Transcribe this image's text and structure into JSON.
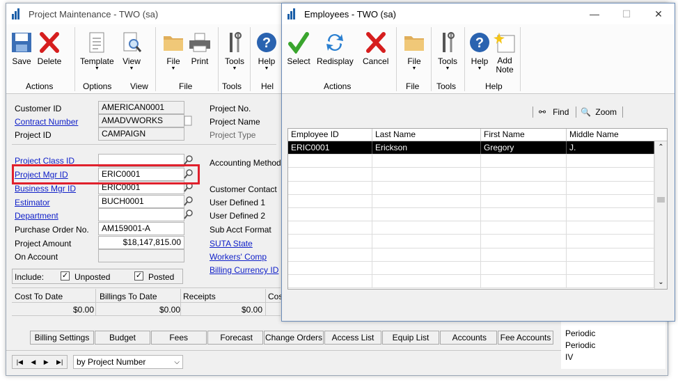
{
  "project_window": {
    "title": "Project Maintenance  -  TWO (sa)",
    "ribbon": {
      "buttons": [
        {
          "label": "Save"
        },
        {
          "label": "Delete"
        },
        {
          "label": "Template"
        },
        {
          "label": "View"
        },
        {
          "label": "File"
        },
        {
          "label": "Print"
        },
        {
          "label": "Tools"
        },
        {
          "label": "Help"
        }
      ],
      "groups": [
        "Actions",
        "Options",
        "View",
        "File",
        "Tools",
        "Hel"
      ]
    },
    "form": {
      "customer_id_label": "Customer ID",
      "customer_id": "AMERICAN0001",
      "contract_number_label": "Contract Number",
      "contract_number": "AMADVWORKS",
      "project_id_label": "Project ID",
      "project_id": "CAMPAIGN",
      "project_no_label": "Project No.",
      "project_name_label": "Project Name",
      "project_type_label": "Project Type",
      "project_class_id_label": "Project Class ID",
      "project_class_id": "",
      "project_mgr_id_label": "Project Mgr ID",
      "project_mgr_id": "ERIC0001",
      "business_mgr_id_label": "Business Mgr ID",
      "business_mgr_id": "ERIC0001",
      "estimator_label": "Estimator",
      "estimator": "BUCH0001",
      "department_label": "Department",
      "department": "",
      "po_label": "Purchase Order No.",
      "po": "AM159001-A",
      "project_amount_label": "Project Amount",
      "project_amount": "$18,147,815.00",
      "on_account_label": "On Account",
      "on_account": "",
      "accounting_method_label": "Accounting Method",
      "customer_contact_label": "Customer Contact",
      "user_defined_1_label": "User Defined 1",
      "user_defined_2_label": "User Defined 2",
      "sub_acct_format_label": "Sub Acct Format",
      "suta_state_label": "SUTA State",
      "workers_comp_label": "Workers' Comp",
      "billing_currency_label": "Billing Currency ID",
      "include_label": "Include:",
      "unposted_label": "Unposted",
      "posted_label": "Posted",
      "unposted_checked": true,
      "posted_checked": true,
      "cost_to_date_label": "Cost To Date",
      "cost_to_date": "$0.00",
      "billings_to_date_label": "Billings To Date",
      "billings_to_date": "$0.00",
      "receipts_label": "Receipts",
      "receipts": "$0.00",
      "cos_label": "Cos"
    },
    "tabs": [
      "Billing Settings",
      "Budget",
      "Fees",
      "Forecast",
      "Change Orders",
      "Access List",
      "Equip List",
      "Accounts",
      "Fee Accounts"
    ],
    "sort_by": "by Project Number",
    "behind_list": [
      "Periodic",
      "Periodic",
      "IV"
    ]
  },
  "employees_window": {
    "title": "Employees  -  TWO (sa)",
    "ribbon": {
      "buttons": [
        {
          "label": "Select"
        },
        {
          "label": "Redisplay"
        },
        {
          "label": "Cancel"
        },
        {
          "label": "File"
        },
        {
          "label": "Tools"
        },
        {
          "label": "Help"
        },
        {
          "label": "Add\nNote"
        }
      ],
      "groups": [
        "Actions",
        "File",
        "Tools",
        "Help"
      ]
    },
    "find_label": "Find",
    "zoom_label": "Zoom",
    "columns": [
      "Employee ID",
      "Last Name",
      "First Name",
      "Middle Name"
    ],
    "rows": [
      {
        "employee_id": "ERIC0001",
        "last_name": "Erickson",
        "first_name": "Gregory",
        "middle_name": "J."
      }
    ]
  },
  "colors": {
    "highlight": "#e0202c",
    "link": "#1020c8",
    "selection": "#000000"
  }
}
